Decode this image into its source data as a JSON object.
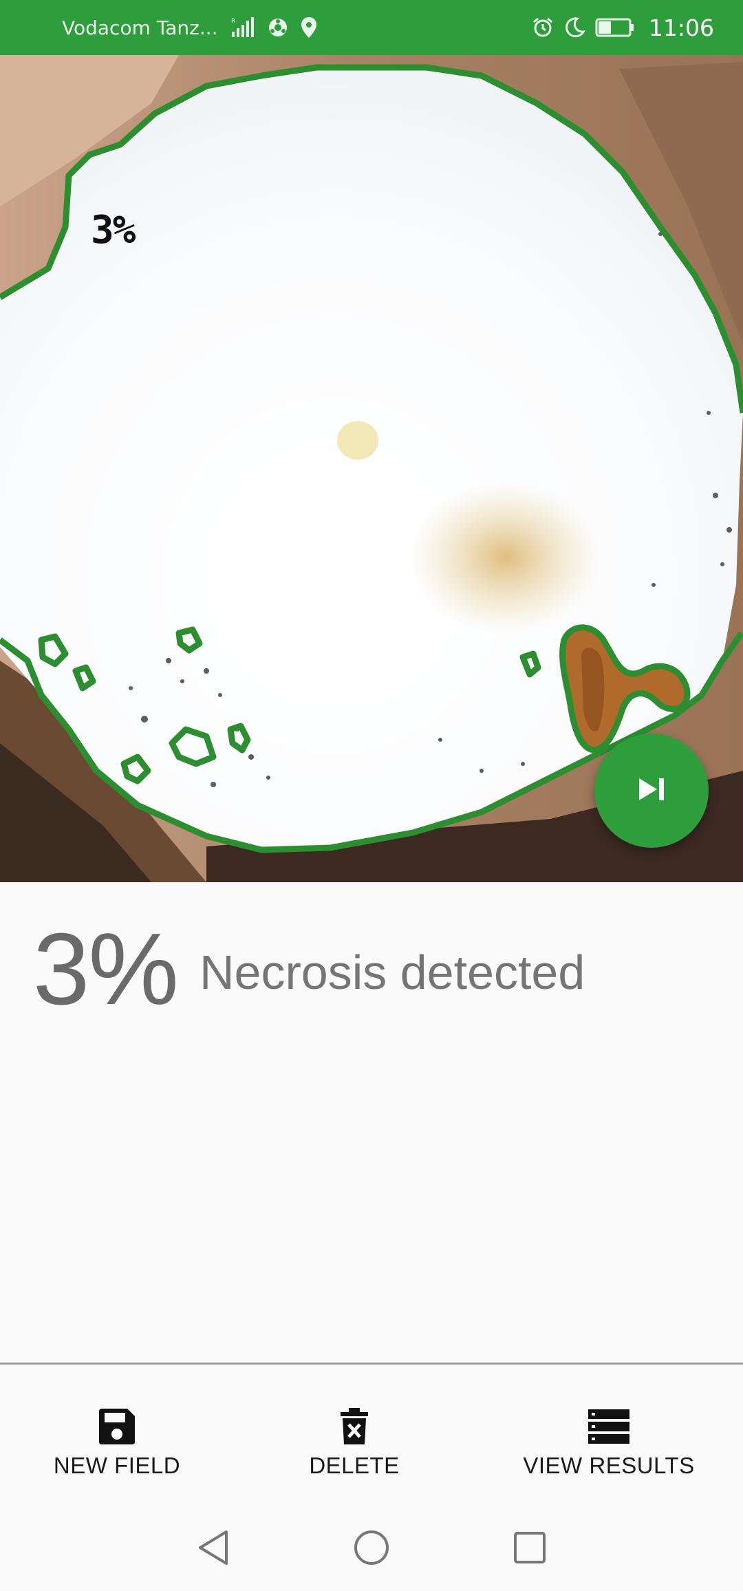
{
  "status_bar": {
    "carrier": "Vodacom Tanz...",
    "time": "11:06",
    "background": "#2e9e3c",
    "icons": [
      "signal-icon",
      "data-icon",
      "location-icon",
      "alarm-icon",
      "do-not-disturb-icon",
      "battery-icon"
    ],
    "battery_level": 0.4
  },
  "photo": {
    "overlay_label": "3%",
    "outline_color": "#2b8f2f"
  },
  "fab": {
    "icon": "skip-next-icon",
    "color": "#2e9e3c"
  },
  "result": {
    "percent": "3%",
    "label": "Necrosis detected"
  },
  "bottom_nav": {
    "items": [
      {
        "label": "NEW FIELD",
        "icon": "save-icon"
      },
      {
        "label": "DELETE",
        "icon": "delete-icon"
      },
      {
        "label": "VIEW RESULTS",
        "icon": "list-icon"
      }
    ]
  },
  "system_nav": {
    "icons": [
      "back-icon",
      "home-icon",
      "recents-icon"
    ]
  }
}
